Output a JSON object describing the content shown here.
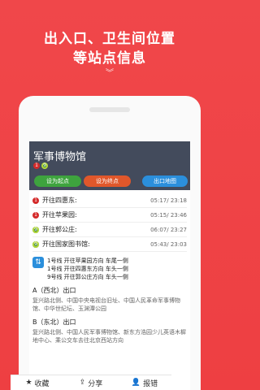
{
  "promo": {
    "line1": "出入口、卫生间位置",
    "line2": "等站点信息",
    "chevron": "︾"
  },
  "station": {
    "name": "军事博物馆",
    "line_badges": [
      "1",
      "9"
    ],
    "buttons": {
      "set_start": "设为起点",
      "set_end": "设为终点",
      "exit_map": "出口地图"
    }
  },
  "trains": [
    {
      "dest": "开往四惠东:",
      "line": "1",
      "indicator": "red",
      "time": "05:17/ 23:18"
    },
    {
      "dest": "开往苹果园:",
      "line": "1",
      "indicator": "red",
      "time": "05:15/ 23:46"
    },
    {
      "dest": "开往郭公庄:",
      "line": "9",
      "indicator": "green",
      "time": "06:07/ 23:27"
    },
    {
      "dest": "开往国家图书馆:",
      "line": "9",
      "indicator": "green",
      "time": "05:43/ 23:03"
    }
  ],
  "directions": {
    "icon": "⇅",
    "lines": [
      "1号线 开往苹果园方向 车尾一侧",
      "1号线 开往四惠东方向 车头一侧",
      "9号线 开往郭公庄方向 车头一侧"
    ]
  },
  "exits": [
    {
      "name": "A（西北）出口",
      "desc": "复兴路北侧、中国中央电视台旧址、中国人民革命军事博物馆、中华世纪坛、玉渊潭公园"
    },
    {
      "name": "B（东北）出口",
      "desc": "复兴路北侧、中国人民军事博物馆、新东方浩园少儿英语木樨地中心、乘公交车去往北京西站方向"
    }
  ],
  "tabbar": {
    "favorite": "收藏",
    "share": "分享",
    "report": "报错"
  },
  "colors": {
    "background": "#ee4245",
    "header": "#434b5c",
    "start_button": "#3ea33e",
    "end_button": "#e0572b",
    "map_button": "#2b8fdc"
  }
}
